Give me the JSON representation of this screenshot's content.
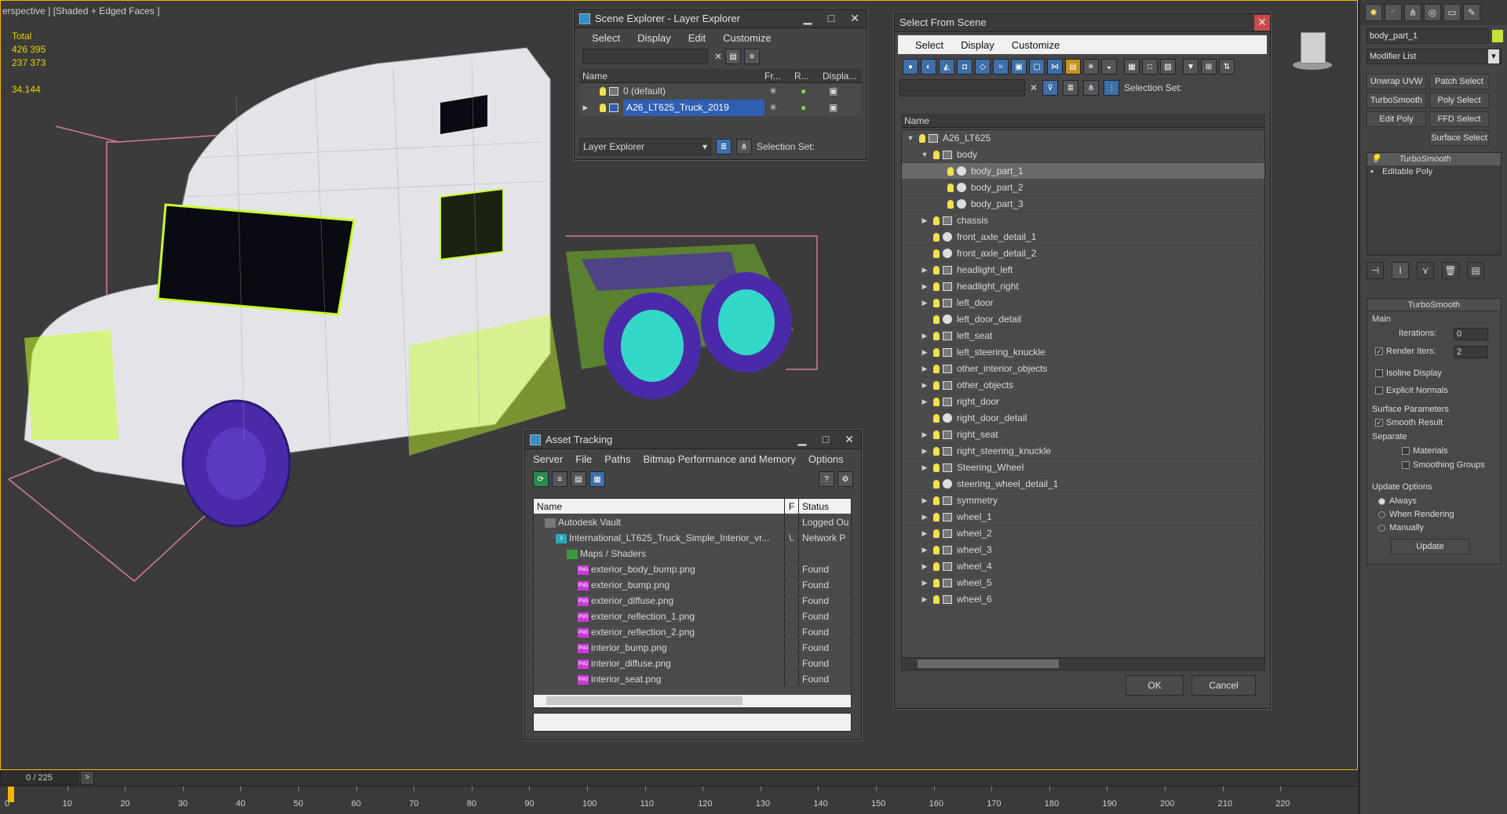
{
  "viewport": {
    "label": "erspective ] [Shaded + Edged Faces ]",
    "stats_total_label": "Total",
    "stats_1": "426 395",
    "stats_2": "237 373",
    "stats_3": "34.144"
  },
  "layer_explorer": {
    "title": "Scene Explorer - Layer Explorer",
    "menu": [
      "Select",
      "Display",
      "Edit",
      "Customize"
    ],
    "columns": [
      "Name",
      "Fr...",
      "R...",
      "Displa..."
    ],
    "rows": [
      {
        "name": "0 (default)"
      },
      {
        "name": "A26_LT625_Truck_2019",
        "selected": true
      }
    ],
    "footer_mode": "Layer Explorer",
    "footer_selection_set": "Selection Set:"
  },
  "select_from_scene": {
    "title": "Select From Scene",
    "menu": [
      "Select",
      "Display",
      "Customize"
    ],
    "selection_set": "Selection Set:",
    "column_name": "Name",
    "tree": [
      {
        "label": "A26_LT625",
        "indent": 0,
        "arrow": "open",
        "icon": "group"
      },
      {
        "label": "body",
        "indent": 1,
        "arrow": "open",
        "icon": "group"
      },
      {
        "label": "body_part_1",
        "indent": 2,
        "arrow": "none",
        "icon": "ball",
        "selected": true
      },
      {
        "label": "body_part_2",
        "indent": 2,
        "arrow": "none",
        "icon": "ball"
      },
      {
        "label": "body_part_3",
        "indent": 2,
        "arrow": "none",
        "icon": "ball"
      },
      {
        "label": "chassis",
        "indent": 1,
        "arrow": "closed",
        "icon": "group"
      },
      {
        "label": "front_axle_detail_1",
        "indent": 1,
        "arrow": "none",
        "icon": "ball"
      },
      {
        "label": "front_axle_detail_2",
        "indent": 1,
        "arrow": "none",
        "icon": "ball"
      },
      {
        "label": "headlight_left",
        "indent": 1,
        "arrow": "closed",
        "icon": "group"
      },
      {
        "label": "headlight_right",
        "indent": 1,
        "arrow": "closed",
        "icon": "group"
      },
      {
        "label": "left_door",
        "indent": 1,
        "arrow": "closed",
        "icon": "group"
      },
      {
        "label": "left_door_detail",
        "indent": 1,
        "arrow": "none",
        "icon": "ball"
      },
      {
        "label": "left_seat",
        "indent": 1,
        "arrow": "closed",
        "icon": "group"
      },
      {
        "label": "left_steering_knuckle",
        "indent": 1,
        "arrow": "closed",
        "icon": "group"
      },
      {
        "label": "other_interior_objects",
        "indent": 1,
        "arrow": "closed",
        "icon": "group"
      },
      {
        "label": "other_objects",
        "indent": 1,
        "arrow": "closed",
        "icon": "group"
      },
      {
        "label": "right_door",
        "indent": 1,
        "arrow": "closed",
        "icon": "group"
      },
      {
        "label": "right_door_detail",
        "indent": 1,
        "arrow": "none",
        "icon": "ball"
      },
      {
        "label": "right_seat",
        "indent": 1,
        "arrow": "closed",
        "icon": "group"
      },
      {
        "label": "right_steering_knuckle",
        "indent": 1,
        "arrow": "closed",
        "icon": "group"
      },
      {
        "label": "Steering_Wheel",
        "indent": 1,
        "arrow": "closed",
        "icon": "group"
      },
      {
        "label": "steering_wheel_detail_1",
        "indent": 1,
        "arrow": "none",
        "icon": "ball"
      },
      {
        "label": "symmetry",
        "indent": 1,
        "arrow": "closed",
        "icon": "group"
      },
      {
        "label": "wheel_1",
        "indent": 1,
        "arrow": "closed",
        "icon": "group"
      },
      {
        "label": "wheel_2",
        "indent": 1,
        "arrow": "closed",
        "icon": "group"
      },
      {
        "label": "wheel_3",
        "indent": 1,
        "arrow": "closed",
        "icon": "group"
      },
      {
        "label": "wheel_4",
        "indent": 1,
        "arrow": "closed",
        "icon": "group"
      },
      {
        "label": "wheel_5",
        "indent": 1,
        "arrow": "closed",
        "icon": "group"
      },
      {
        "label": "wheel_6",
        "indent": 1,
        "arrow": "closed",
        "icon": "group"
      }
    ],
    "ok": "OK",
    "cancel": "Cancel"
  },
  "asset_tracking": {
    "title": "Asset Tracking",
    "menu": [
      "Server",
      "File",
      "Paths",
      "Bitmap Performance and Memory",
      "Options"
    ],
    "col_name": "Name",
    "col_f": "F",
    "col_status": "Status",
    "rows": [
      {
        "name": "Autodesk Vault",
        "f": "",
        "status": "Logged Ou",
        "indent": 1,
        "kind": "vault"
      },
      {
        "name": "International_LT625_Truck_Simple_Interior_vr...",
        "f": "\\.",
        "status": "Network P",
        "indent": 2,
        "kind": "max"
      },
      {
        "name": "Maps / Shaders",
        "f": "",
        "status": "",
        "indent": 3,
        "kind": "maps"
      },
      {
        "name": "exterior_body_bump.png",
        "f": "",
        "status": "Found",
        "indent": 4,
        "kind": "png"
      },
      {
        "name": "exterior_bump.png",
        "f": "",
        "status": "Found",
        "indent": 4,
        "kind": "png"
      },
      {
        "name": "exterior_diffuse.png",
        "f": "",
        "status": "Found",
        "indent": 4,
        "kind": "png"
      },
      {
        "name": "exterior_reflection_1.png",
        "f": "",
        "status": "Found",
        "indent": 4,
        "kind": "png"
      },
      {
        "name": "exterior_reflection_2.png",
        "f": "",
        "status": "Found",
        "indent": 4,
        "kind": "png"
      },
      {
        "name": "interior_bump.png",
        "f": "",
        "status": "Found",
        "indent": 4,
        "kind": "png"
      },
      {
        "name": "interior_diffuse.png",
        "f": "",
        "status": "Found",
        "indent": 4,
        "kind": "png"
      },
      {
        "name": "interior_seat.png",
        "f": "",
        "status": "Found",
        "indent": 4,
        "kind": "png"
      }
    ]
  },
  "command_panel": {
    "object_name": "body_part_1",
    "modifier_list": "Modifier List",
    "buttons": [
      "Unwrap UVW",
      "Patch Select",
      "TurboSmooth",
      "Poly Select",
      "Edit Poly",
      "FFD Select",
      "Surface Select"
    ],
    "stack": [
      "TurboSmooth",
      "Editable Poly"
    ],
    "turbosmooth": {
      "title": "TurboSmooth",
      "main": "Main",
      "iterations_label": "Iterations:",
      "iterations": "0",
      "render_iters_label": "Render Iters:",
      "render_iters": "2",
      "isoline": "Isoline Display",
      "explicit_normals": "Explicit Normals",
      "surface_params": "Surface Parameters",
      "smooth_result": "Smooth Result",
      "separate": "Separate",
      "materials": "Materials",
      "smoothing_groups": "Smoothing Groups",
      "update_options": "Update Options",
      "always": "Always",
      "when_rendering": "When Rendering",
      "manually": "Manually",
      "update": "Update"
    }
  },
  "timeline": {
    "frame": "0 / 225",
    "next": ">",
    "ticks": [
      "0",
      "10",
      "20",
      "30",
      "40",
      "50",
      "60",
      "70",
      "80",
      "90",
      "100",
      "110",
      "120",
      "130",
      "140",
      "150",
      "160",
      "170",
      "180",
      "190",
      "200",
      "210",
      "220"
    ]
  },
  "colors": {
    "accent": "#f2b600",
    "selection": "#2f5fb3",
    "wire": "#c8ff2a",
    "wheel": "#4a2aa8"
  }
}
